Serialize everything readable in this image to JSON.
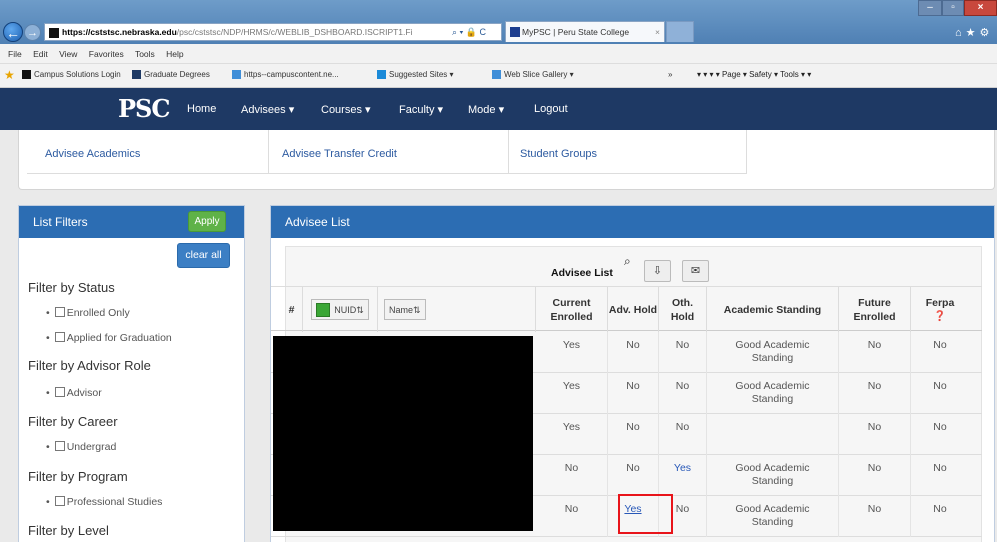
{
  "browser": {
    "address_host": "https://cststsc.nebraska.edu",
    "address_path": "/psc/cststsc/NDP/HRMS/c/WEBLIB_DSHBOARD.ISCRIPT1.Fi",
    "address_controls": "⌕ ▾ 🔒 C",
    "tab_title": "MyPSC | Peru State College",
    "tab_close": "×",
    "menu": [
      "File",
      "Edit",
      "View",
      "Favorites",
      "Tools",
      "Help"
    ],
    "favorites": [
      "Campus Solutions Login",
      "Graduate Degrees",
      "https--campuscontent.ne...",
      "Suggested Sites ▾",
      "Web Slice Gallery ▾"
    ],
    "fav_chevron": "»",
    "tools": "▾  ▾  ▾  ▾ Page ▾  Safety ▾  Tools ▾ ▾"
  },
  "site": {
    "logo": "PSC",
    "nav": [
      "Home",
      "Advisees ▾",
      "Courses ▾",
      "Faculty ▾",
      "Mode ▾",
      "Logout"
    ]
  },
  "links": [
    "Advisee Academics",
    "Advisee Transfer Credit",
    "Student Groups"
  ],
  "filters": {
    "title": "List Filters",
    "apply": "Apply",
    "clear": "clear all",
    "groups": [
      {
        "label": "Filter by Status",
        "options": [
          "Enrolled Only",
          "Applied for Graduation"
        ]
      },
      {
        "label": "Filter by Advisor Role",
        "options": [
          "Advisor"
        ]
      },
      {
        "label": "Filter by Career",
        "options": [
          "Undergrad"
        ]
      },
      {
        "label": "Filter by Program",
        "options": [
          "Professional Studies"
        ]
      },
      {
        "label": "Filter by Level",
        "options": []
      }
    ]
  },
  "advisees": {
    "title": "Advisee List",
    "caption": "Advisee List",
    "headers": {
      "num": "#",
      "nuid": "NUID⇅",
      "name": "Name⇅",
      "current_enrolled": "Current Enrolled",
      "adv_hold": "Adv. Hold",
      "oth_hold": "Oth. Hold",
      "academic_standing": "Academic Standing",
      "future_enrolled": "Future Enrolled",
      "ferpa": "Ferpa",
      "ferpa_icon": "❓"
    },
    "rows": [
      {
        "current": "Yes",
        "adv": "No",
        "oth": "No",
        "standing": "Good Academic Standing",
        "future": "No",
        "ferpa": "No"
      },
      {
        "current": "Yes",
        "adv": "No",
        "oth": "No",
        "standing": "Good Academic Standing",
        "future": "No",
        "ferpa": "No"
      },
      {
        "current": "Yes",
        "adv": "No",
        "oth": "No",
        "standing": "",
        "future": "No",
        "ferpa": "No"
      },
      {
        "current": "No",
        "adv": "No",
        "oth": "Yes",
        "standing": "Good Academic Standing",
        "future": "No",
        "ferpa": "No"
      },
      {
        "current": "No",
        "adv": "Yes",
        "oth": "No",
        "standing": "Good Academic Standing",
        "future": "No",
        "ferpa": "No"
      }
    ]
  }
}
